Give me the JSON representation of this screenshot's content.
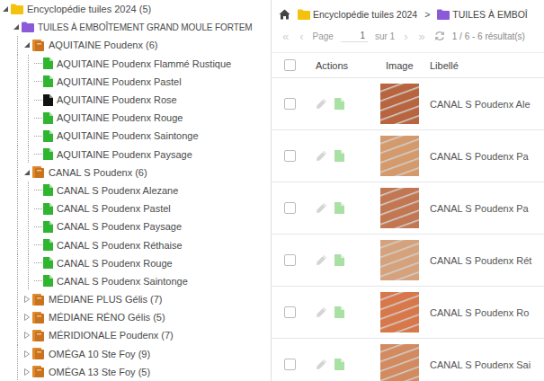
{
  "tree": {
    "items": [
      {
        "label": "Encyclopédie tuiles 2024 (5)",
        "kind": "root",
        "expanded": true,
        "children": [
          {
            "label": "TUILES À EMBOÎTEMENT GRAND MOULE FORTEM",
            "kind": "category",
            "expanded": true,
            "children": [
              {
                "label": "AQUITAINE Poudenx (6)",
                "kind": "model",
                "expanded": true,
                "children": [
                  {
                    "label": "AQUITAINE Poudenx Flammé Rustique",
                    "kind": "tile",
                    "color": "#2fb52f"
                  },
                  {
                    "label": "AQUITAINE Poudenx Pastel",
                    "kind": "tile",
                    "color": "#2fb52f"
                  },
                  {
                    "label": "AQUITAINE Poudenx Rose",
                    "kind": "tile",
                    "color": "#111111"
                  },
                  {
                    "label": "AQUITAINE Poudenx Rouge",
                    "kind": "tile",
                    "color": "#2fb52f"
                  },
                  {
                    "label": "AQUITAINE Poudenx Saintonge",
                    "kind": "tile",
                    "color": "#2fb52f"
                  },
                  {
                    "label": "AQUITAINE Poudenx Paysage",
                    "kind": "tile",
                    "color": "#2fb52f"
                  }
                ]
              },
              {
                "label": "CANAL S Poudenx (6)",
                "kind": "model",
                "expanded": true,
                "children": [
                  {
                    "label": "CANAL S Poudenx Alezane",
                    "kind": "tile",
                    "color": "#2fb52f"
                  },
                  {
                    "label": "CANAL S Poudenx Pastel",
                    "kind": "tile",
                    "color": "#2fb52f"
                  },
                  {
                    "label": "CANAL S Poudenx Paysage",
                    "kind": "tile",
                    "color": "#2fb52f"
                  },
                  {
                    "label": "CANAL S Poudenx Réthaise",
                    "kind": "tile",
                    "color": "#2fb52f"
                  },
                  {
                    "label": "CANAL S Poudenx Rouge",
                    "kind": "tile",
                    "color": "#2fb52f"
                  },
                  {
                    "label": "CANAL S Poudenx Saintonge",
                    "kind": "tile",
                    "color": "#2fb52f"
                  }
                ]
              },
              {
                "label": "MÉDIANE PLUS Gélis (7)",
                "kind": "model",
                "expanded": false,
                "children": []
              },
              {
                "label": "MÉDIANE RÉNO Gélis (5)",
                "kind": "model",
                "expanded": false,
                "children": []
              },
              {
                "label": "MÉRIDIONALE Poudenx (7)",
                "kind": "model",
                "expanded": false,
                "children": []
              },
              {
                "label": "OMÉGA 10 Ste Foy (9)",
                "kind": "model",
                "expanded": false,
                "children": []
              },
              {
                "label": "OMÉGA 13 Ste Foy (5)",
                "kind": "model",
                "expanded": false,
                "children": []
              }
            ]
          }
        ]
      }
    ]
  },
  "breadcrumb": {
    "separator": ">",
    "items": [
      {
        "label": "Encyclopédie tuiles 2024",
        "kind": "root"
      },
      {
        "label": "TUILES À EMBOÎ",
        "kind": "category"
      }
    ]
  },
  "pager": {
    "first": "«",
    "prev": "‹",
    "page_label": "Page",
    "page": "1",
    "of": "sur 1",
    "next": "›",
    "last": "»",
    "summary": "1 / 6 - 6 résultat(s)",
    "disabled": true
  },
  "table": {
    "columns": [
      "Actions",
      "Image",
      "Libellé"
    ],
    "all_selected": false,
    "rows": [
      {
        "label": "CANAL S Poudenx Ale",
        "selected": false,
        "color": "#b8653f"
      },
      {
        "label": "CANAL S Poudenx Pa",
        "selected": false,
        "color": "#d49a6c"
      },
      {
        "label": "CANAL S Poudenx Pa",
        "selected": false,
        "color": "#c27752"
      },
      {
        "label": "CANAL S Poudenx Rét",
        "selected": false,
        "color": "#d6a27c"
      },
      {
        "label": "CANAL S Poudenx Ro",
        "selected": false,
        "color": "#d8784a"
      },
      {
        "label": "CANAL S Poudenx Sai",
        "selected": false,
        "color": "#d28a5e"
      }
    ]
  }
}
